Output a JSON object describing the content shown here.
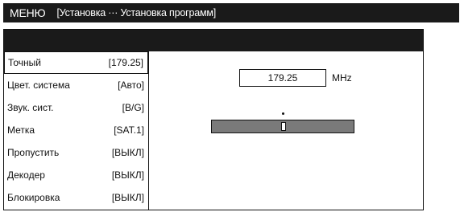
{
  "title_bar": {
    "menu": "МЕНЮ",
    "breadcrumb": "[Установка ··· Установка программ]"
  },
  "settings": [
    {
      "label": "Точный",
      "value": "[179.25]",
      "selected": true
    },
    {
      "label": "Цвет. система",
      "value": "[Авто]"
    },
    {
      "label": "Звук. сист.",
      "value": "[B/G]"
    },
    {
      "label": "Метка",
      "value": "[SAT.1]"
    },
    {
      "label": "Пропустить",
      "value": "[ВЫКЛ]"
    },
    {
      "label": "Декодер",
      "value": "[ВЫКЛ]"
    },
    {
      "label": "Блокировка",
      "value": "[ВЫКЛ]"
    }
  ],
  "frequency": {
    "value": "179.25",
    "unit": "MHz"
  },
  "fine_tune": {
    "position_fraction": 0.5
  },
  "colors": {
    "header": "#1a1a1a",
    "bar": "#7a7a7a"
  }
}
